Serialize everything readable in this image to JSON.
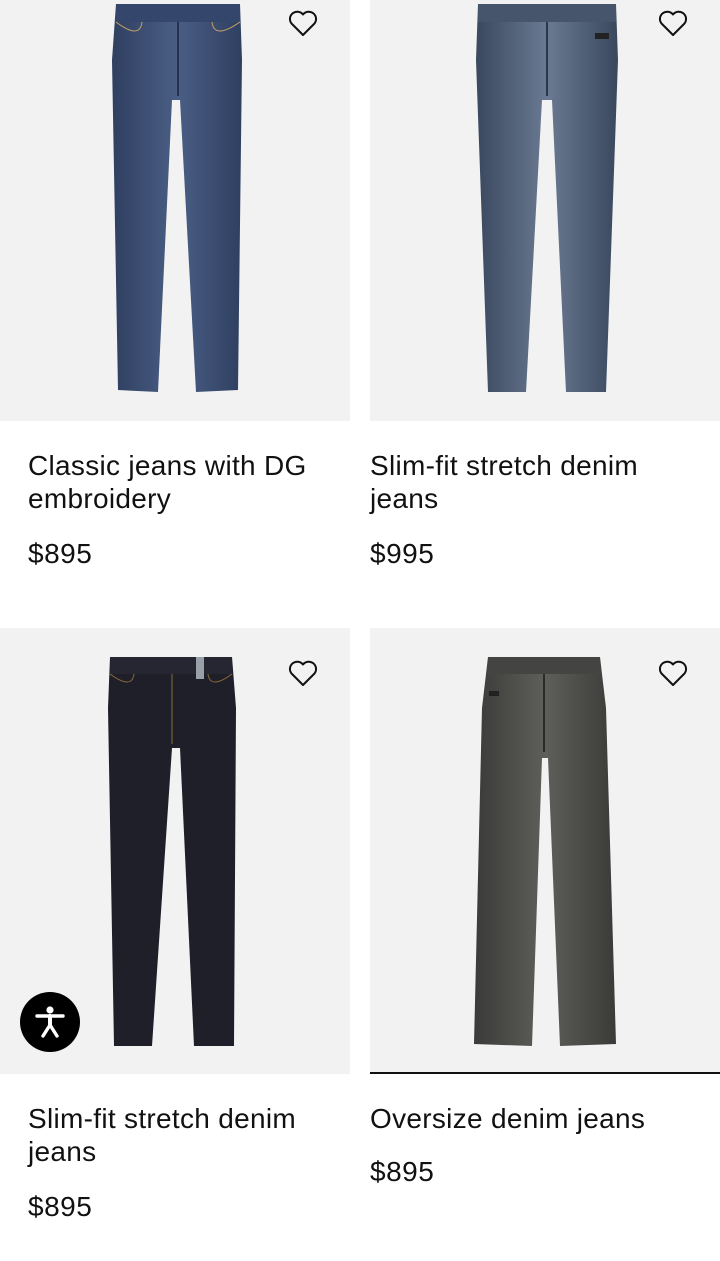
{
  "products": [
    {
      "title": "Classic jeans with DG embroidery",
      "price": "$895",
      "favorite_icon": "heart-outline-icon",
      "color": "#3f5276"
    },
    {
      "title": "Slim-fit stretch denim jeans",
      "price": "$995",
      "favorite_icon": "heart-outline-icon",
      "color": "#4a5a72"
    },
    {
      "title": "Slim-fit stretch denim jeans",
      "price": "$895",
      "favorite_icon": "heart-outline-icon",
      "color": "#1e1e28"
    },
    {
      "title": "Oversize denim jeans",
      "price": "$895",
      "favorite_icon": "heart-outline-icon",
      "color": "#4a4a48"
    }
  ],
  "accessibility_button": {
    "icon": "accessibility-person-icon"
  }
}
